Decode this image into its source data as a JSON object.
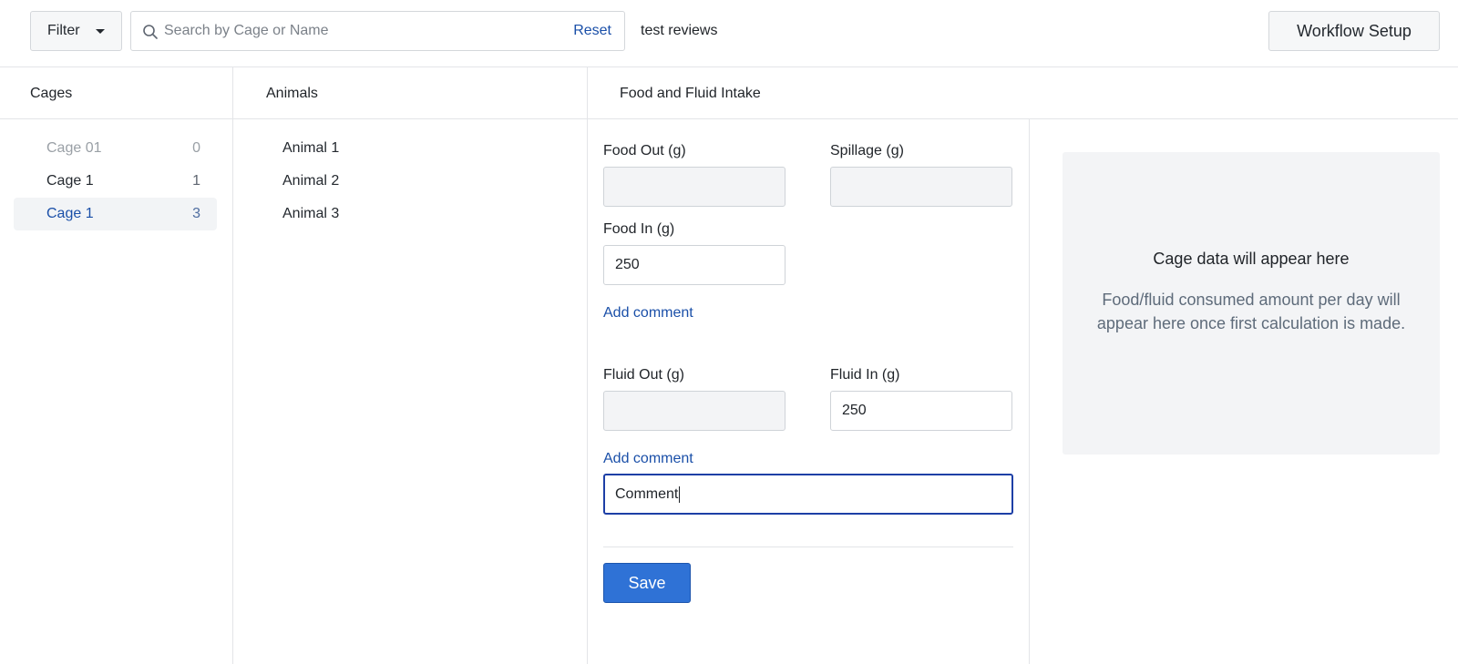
{
  "topbar": {
    "filter_label": "Filter",
    "search_placeholder": "Search by Cage or Name",
    "reset_label": "Reset",
    "workflow_name": "test reviews",
    "workflow_setup_label": "Workflow Setup"
  },
  "columns": {
    "cages_title": "Cages",
    "animals_title": "Animals",
    "intake_title": "Food and Fluid Intake"
  },
  "cages": [
    {
      "name": "Cage 01",
      "count": "0",
      "state": "muted"
    },
    {
      "name": "Cage 1",
      "count": "1",
      "state": "normal"
    },
    {
      "name": "Cage 1",
      "count": "3",
      "state": "selected"
    }
  ],
  "animals": [
    {
      "name": "Animal 1"
    },
    {
      "name": "Animal 2"
    },
    {
      "name": "Animal 3"
    }
  ],
  "form": {
    "food_out_label": "Food Out (g)",
    "food_out_value": "",
    "spillage_label": "Spillage (g)",
    "spillage_value": "",
    "food_in_label": "Food In (g)",
    "food_in_value": "250",
    "add_comment_label": "Add comment",
    "fluid_out_label": "Fluid Out (g)",
    "fluid_out_value": "",
    "fluid_in_label": "Fluid In (g)",
    "fluid_in_value": "250",
    "comment_value": "Comment",
    "save_label": "Save"
  },
  "info_panel": {
    "title": "Cage data will appear here",
    "body": "Food/fluid consumed amount per day will appear here once first calculation is made."
  },
  "colors": {
    "accent": "#2f72d6",
    "link": "#1a4fa8",
    "focus_border": "#1d3fa6",
    "panel_bg": "#f3f4f6"
  },
  "icons": {
    "search": "search-icon",
    "filter_caret": "caret-down-icon"
  }
}
